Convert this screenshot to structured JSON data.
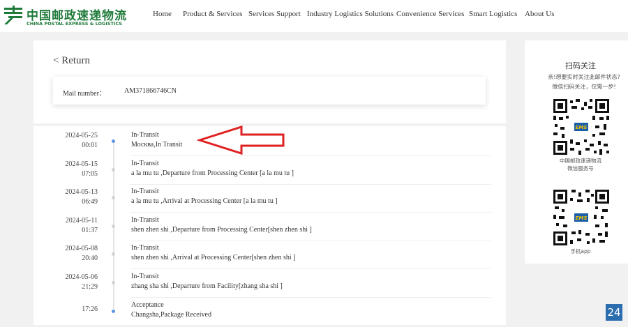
{
  "header": {
    "logo_cn": "中国邮政速递物流",
    "logo_en": "CHINA POSTAL EXPRESS & LOGISTICS",
    "nav": [
      {
        "label": "Home"
      },
      {
        "label": "Product & Services"
      },
      {
        "label": "Services Support"
      },
      {
        "label": "Industry Logistics Solutions"
      },
      {
        "label": "Convenience Services"
      },
      {
        "label": "Smart Logistics"
      },
      {
        "label": "About Us"
      }
    ]
  },
  "main": {
    "return_label": "< Return",
    "mail_label": "Mail number：",
    "mail_number": "AM371866746CN",
    "timeline": [
      {
        "date": "2024-05-25",
        "time": "00:01",
        "status": "In-Transit",
        "desc": "Москва,In Transit",
        "active": true
      },
      {
        "date": "2024-05-15",
        "time": "07:05",
        "status": "In-Transit",
        "desc": "a la mu tu ,Departure from Processing Center [a la mu tu ]",
        "active": false
      },
      {
        "date": "2024-05-13",
        "time": "06:49",
        "status": "In-Transit",
        "desc": "a la mu tu ,Arrival at Processing Center [a la mu tu ]",
        "active": false
      },
      {
        "date": "2024-05-11",
        "time": "01:37",
        "status": "In-Transit",
        "desc": "shen zhen shi ,Departure from Processing Center[shen zhen shi ]",
        "active": false
      },
      {
        "date": "2024-05-08",
        "time": "20:40",
        "status": "In-Transit",
        "desc": "shen zhen shi ,Arrival at Processing Center[shen zhen shi ]",
        "active": false
      },
      {
        "date": "2024-05-06",
        "time": "21:29",
        "status": "In-Transit",
        "desc": "zhang sha shi ,Departure from Facility[zhang sha shi ]",
        "active": false
      },
      {
        "date": "",
        "time": "17:26",
        "status": "Acceptance",
        "desc": "Changsha,Package Received",
        "active": true
      }
    ]
  },
  "side": {
    "title": "扫码关注",
    "desc_line1": "亲!想要实时关注此邮件状态?",
    "desc_line2": "微信扫码关注，仅需一步!",
    "qr1_caption_line1": "中国邮政速递物流",
    "qr1_caption_line2": "微信服务号",
    "qr2_caption": "手机app",
    "qr_badge": "EMS"
  },
  "float_button": "24",
  "colors": {
    "brand_green": "#1f7a3a",
    "timeline_active": "#5b97e6",
    "arrow_red": "#e02020",
    "float_blue": "#2c6db0"
  }
}
